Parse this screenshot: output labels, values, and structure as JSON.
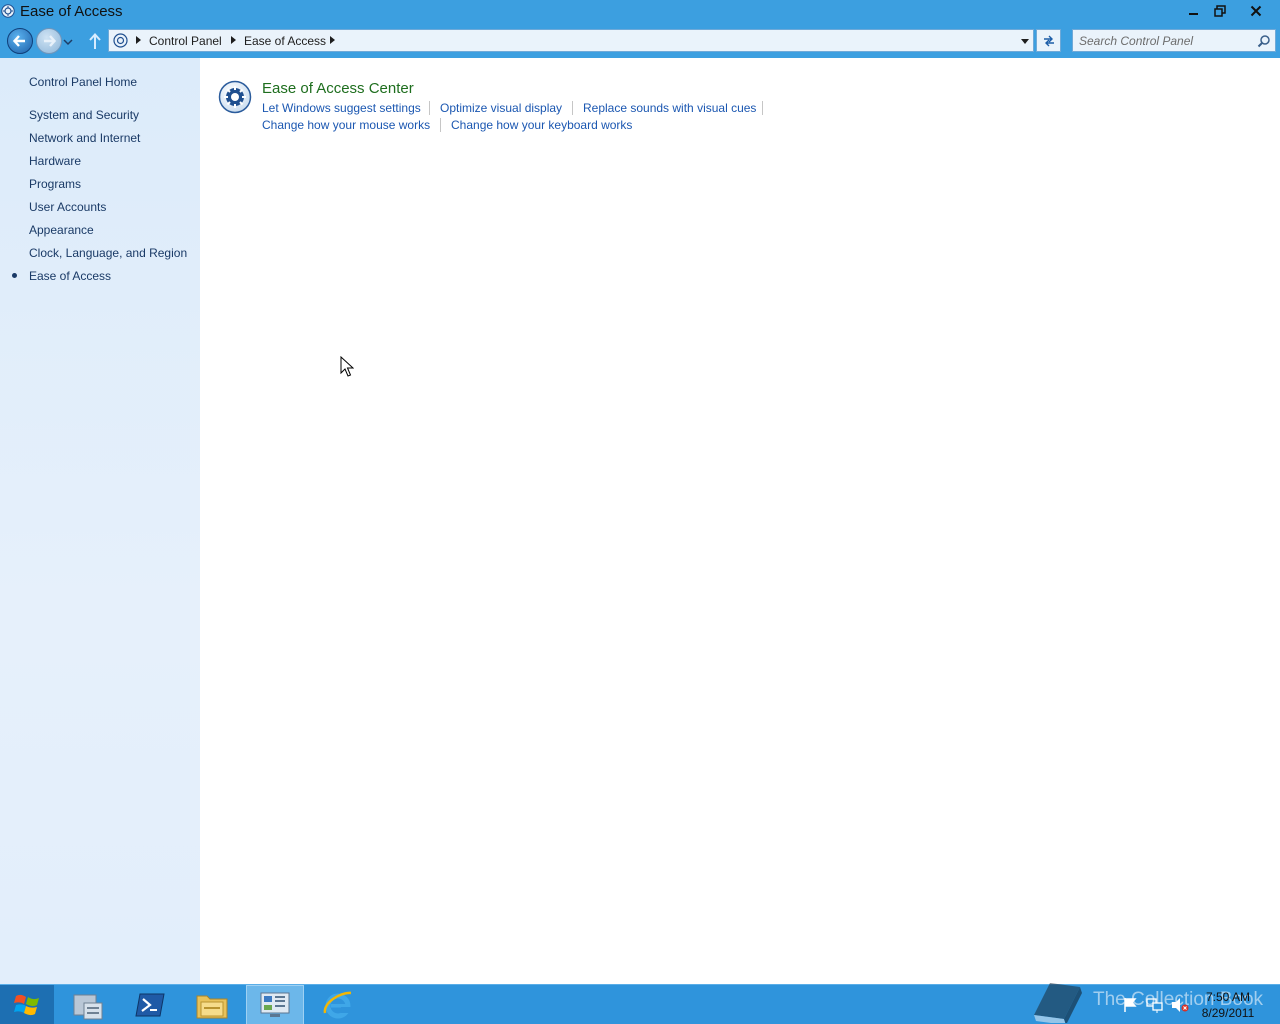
{
  "window": {
    "title": "Ease of Access"
  },
  "navbar": {
    "breadcrumbs": [
      "Control Panel",
      "Ease of Access"
    ],
    "search_placeholder": "Search Control Panel"
  },
  "sidebar": {
    "home": "Control Panel Home",
    "items": [
      {
        "label": "System and Security"
      },
      {
        "label": "Network and Internet"
      },
      {
        "label": "Hardware"
      },
      {
        "label": "Programs"
      },
      {
        "label": "User Accounts"
      },
      {
        "label": "Appearance"
      },
      {
        "label": "Clock, Language, and Region"
      },
      {
        "label": "Ease of Access",
        "current": true
      }
    ]
  },
  "main": {
    "category": {
      "title": "Ease of Access Center",
      "links_row1": [
        "Let Windows suggest settings",
        "Optimize visual display",
        "Replace sounds with visual cues"
      ],
      "links_row2": [
        "Change how your mouse works",
        "Change how your keyboard works"
      ]
    }
  },
  "taskbar": {
    "apps": [
      "server-manager-icon",
      "powershell-icon",
      "file-explorer-icon",
      "control-panel-icon",
      "internet-explorer-icon"
    ],
    "active_app": "control-panel-icon",
    "watermark": "The Collection Book",
    "clock": {
      "time": "7:50 AM",
      "date": "8/29/2011"
    }
  },
  "colors": {
    "titlebar": "#3c9fe0",
    "sidebar_bg": "#dcebfa",
    "link": "#1b57b1",
    "category_title": "#1e6e1e",
    "taskbar": "#2f94dc"
  }
}
